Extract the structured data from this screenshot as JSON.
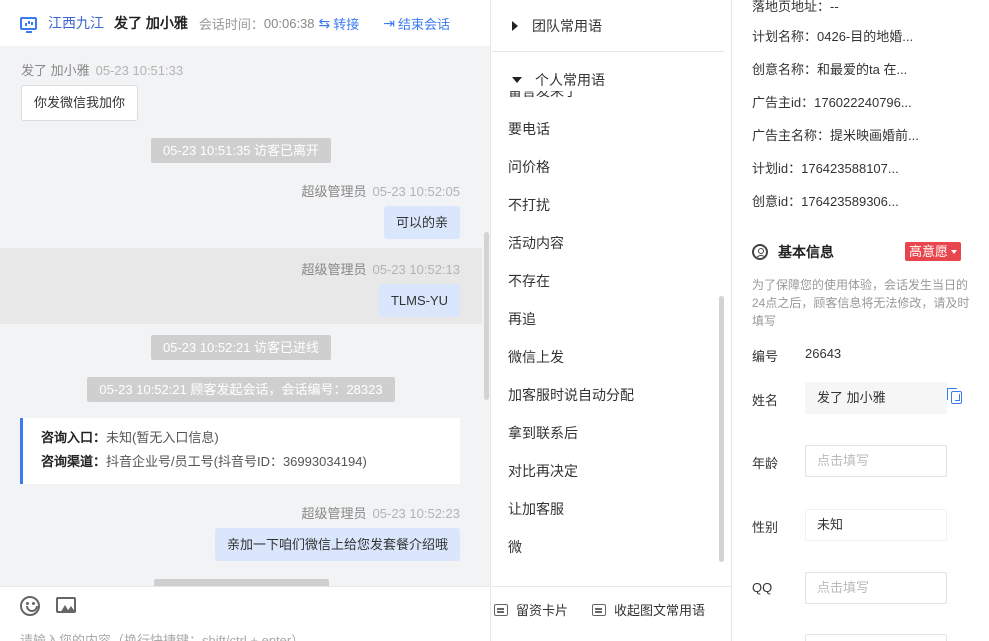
{
  "header": {
    "region": "江西九江",
    "visitor_name": "发了 加小雅",
    "duration_label": "会话时间：",
    "duration": "00:06:38",
    "transfer_label": "转接",
    "end_label": "结束会话"
  },
  "messages": {
    "visitor_msg": {
      "sender": "发了 加小雅",
      "time": "05-23 10:51:33",
      "text": "你发微信我加你"
    },
    "sys_left": "05-23 10:51:35 访客已离开",
    "agent_msg_1": {
      "sender": "超级管理员",
      "time": "05-23 10:52:05",
      "text": "可以的亲"
    },
    "agent_msg_2": {
      "sender": "超级管理员",
      "time": "05-23 10:52:13",
      "text": "TLMS-YU"
    },
    "sys_enter": "05-23 10:52:21 访客已进线",
    "sys_session": "05-23 10:52:21 顾客发起会话，会话编号：28323",
    "card": {
      "entry_label": "咨询入口：",
      "entry_value": "未知(暂无入口信息)",
      "channel_label": "咨询渠道：",
      "channel_value": "抖音企业号/员工号(抖音号ID：36993034194)"
    },
    "agent_msg_3": {
      "sender": "超级管理员",
      "time": "05-23 10:52:23",
      "text": "亲加一下咱们微信上给您发套餐介绍哦"
    }
  },
  "composer": {
    "placeholder": "请输入您的内容（换行快捷键：shift/ctrl + enter）"
  },
  "phrases": {
    "team_group": "团队常用语",
    "personal_group": "个人常用语",
    "items": [
      "留言发来了",
      "要电话",
      "问价格",
      "不打扰",
      "活动内容",
      "不存在",
      "再追",
      "微信上发",
      "加客服时说自动分配",
      "拿到联系后",
      "对比再决定",
      "让加客服",
      "微"
    ],
    "card_button": "留资卡片",
    "collapse_button": "收起图文常用语"
  },
  "info": {
    "landing": "落地页地址：--",
    "plan_name": "计划名称：0426-目的地婚...",
    "creative_name": "创意名称：和最爱的ta 在...",
    "advertiser_id": "广告主id：176022240796...",
    "advertiser_name": "广告主名称：提米映画婚前...",
    "plan_id": "计划id：176423588107...",
    "creative_id": "创意id：176423589306...",
    "basic_title": "基本信息",
    "intent_badge": "高意愿",
    "notice": "为了保障您的使用体验，会话发生当日的24点之后，顾客信息将无法修改，请及时填写",
    "fields": {
      "number_label": "编号",
      "number_value": "26643",
      "name_label": "姓名",
      "name_value": "发了 加小雅",
      "age_label": "年龄",
      "age_placeholder": "点击填写",
      "gender_label": "性别",
      "gender_value": "未知",
      "qq_label": "QQ",
      "qq_placeholder": "点击填写"
    }
  }
}
